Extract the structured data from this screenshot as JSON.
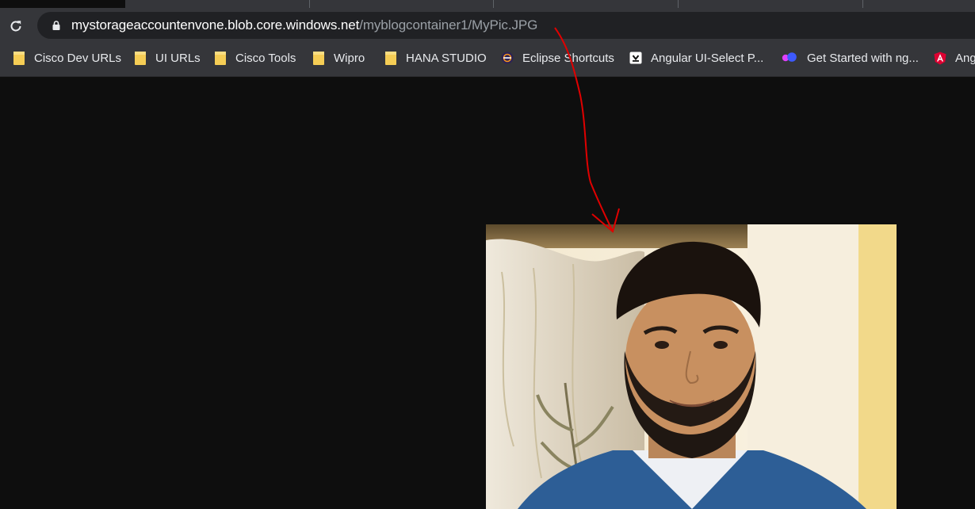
{
  "browser": {
    "address_bar": {
      "host": "mystorageaccountenvone.blob.core.windows.net",
      "path": "/myblogcontainer1/MyPic.JPG"
    },
    "bookmarks": [
      {
        "label": "Cisco Dev URLs",
        "icon": "folder-icon"
      },
      {
        "label": "UI URLs",
        "icon": "folder-icon"
      },
      {
        "label": "Cisco Tools",
        "icon": "folder-icon"
      },
      {
        "label": "Wipro",
        "icon": "folder-icon"
      },
      {
        "label": "HANA STUDIO",
        "icon": "folder-icon"
      },
      {
        "label": "Eclipse Shortcuts",
        "icon": "eclipse-icon"
      },
      {
        "label": "Angular UI-Select P...",
        "icon": "download-icon"
      },
      {
        "label": "Get Started with ng...",
        "icon": "ng-logo-icon"
      },
      {
        "label": "Ang",
        "icon": "angular-icon"
      }
    ]
  },
  "colors": {
    "toolbar": "#35363a",
    "omnibox": "#202124",
    "page_background": "#0e0e0e",
    "annotation_arrow": "#e00000",
    "folder": "#f5cd55"
  }
}
